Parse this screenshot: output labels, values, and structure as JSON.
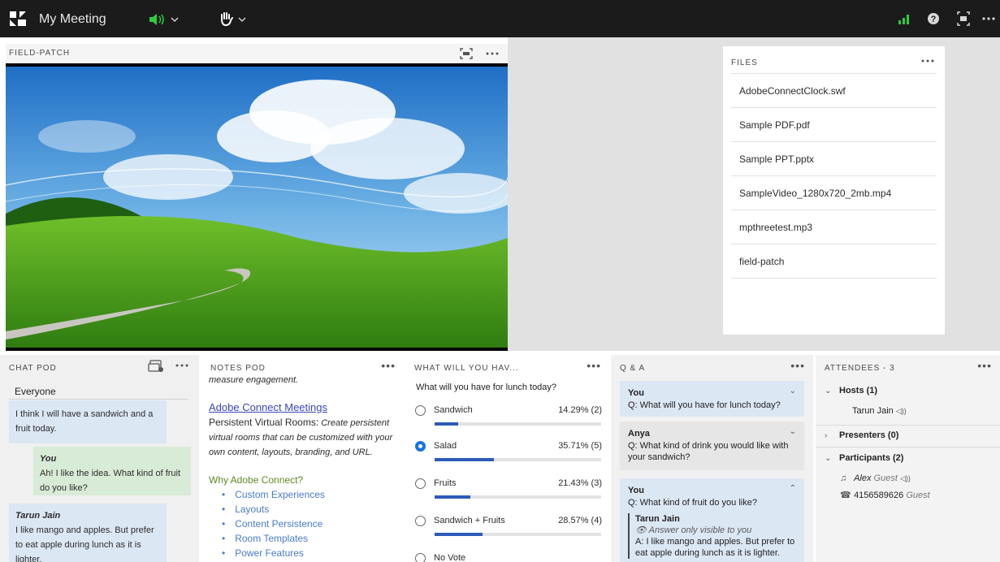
{
  "topbar": {
    "meeting_title": "My Meeting"
  },
  "share_pod": {
    "title": "FIELD-PATCH"
  },
  "files_pod": {
    "title": "FILES",
    "files": [
      "AdobeConnectClock.swf",
      "Sample PDF.pdf",
      "Sample PPT.pptx",
      "SampleVideo_1280x720_2mb.mp4",
      "mpthreetest.mp3",
      "field-patch"
    ]
  },
  "chat_pod": {
    "title": "CHAT POD",
    "recipient": "Everyone",
    "messages": [
      {
        "text": "I think I will have a sandwich and a fruit today."
      },
      {
        "author": "You",
        "text": "Ah! I like the idea. What kind of fruit do you like?"
      },
      {
        "author": "Tarun Jain",
        "text": "I like mango and apples. But prefer to eat apple during lunch as it is lighter."
      }
    ]
  },
  "notes_pod": {
    "title": "NOTES POD",
    "top_text": "measure engagement.",
    "link": "Adobe Connect Meetings",
    "bold_text": "Persistent Virtual Rooms:",
    "italic_text": "Create persistent virtual rooms that can be customized with your own content, layouts, branding, and URL.",
    "heading": "Why Adobe Connect?",
    "bullets": [
      "Custom Experiences",
      "Layouts",
      "Content Persistence",
      "Room Templates",
      "Power Features"
    ]
  },
  "poll_pod": {
    "title": "WHAT WILL YOU HAV...",
    "question": "What will you have for lunch today?",
    "options": [
      {
        "label": "Sandwich",
        "result": "14.29% (2)",
        "share": 14.29,
        "selected": false
      },
      {
        "label": "Salad",
        "result": "35.71% (5)",
        "share": 35.71,
        "selected": true
      },
      {
        "label": "Fruits",
        "result": "21.43% (3)",
        "share": 21.43,
        "selected": false
      },
      {
        "label": "Sandwich + Fruits",
        "result": "28.57% (4)",
        "share": 28.57,
        "selected": false
      },
      {
        "label": "No Vote",
        "result": "",
        "share": 0,
        "selected": false
      }
    ]
  },
  "qa_pod": {
    "title": "Q & A",
    "questions": [
      {
        "author": "You",
        "text": "Q: What will you have for lunch today?"
      },
      {
        "author": "Anya",
        "text": "Q: What kind of drink you would like with your sandwich?"
      },
      {
        "author": "You",
        "text": "Q: What kind of fruit do you like?",
        "answer": {
          "author": "Tarun Jain",
          "note": "Answer only visible to you",
          "text": "A: I like mango and apples. But prefer to eat apple during lunch as it is lighter."
        }
      }
    ]
  },
  "attendees_pod": {
    "title": "ATTENDEES - 3",
    "hosts_label": "Hosts (1)",
    "host_name": "Tarun Jain",
    "presenters_label": "Presenters (0)",
    "participants_label": "Participants (2)",
    "participants": [
      {
        "name": "Alex",
        "role": "Guest"
      },
      {
        "name": "4156589626",
        "role": "Guest"
      }
    ]
  }
}
